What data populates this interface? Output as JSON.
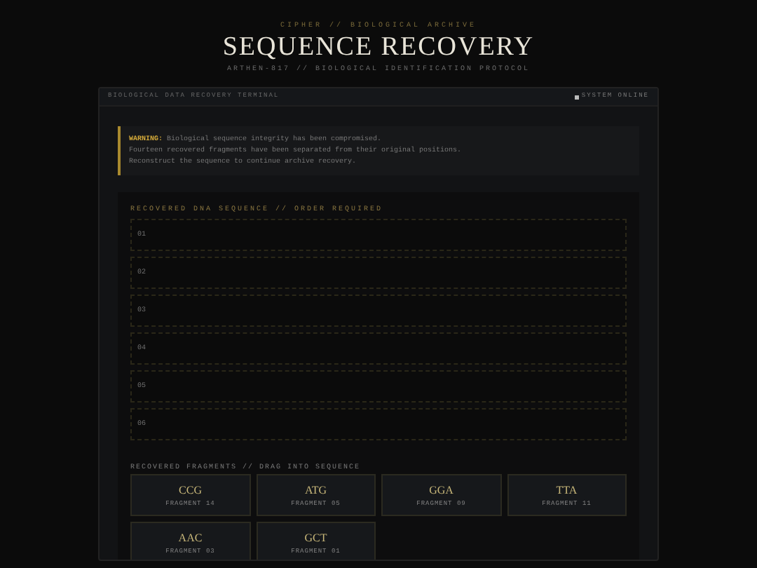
{
  "header": {
    "eyebrow": "CIPHER // BIOLOGICAL ARCHIVE",
    "title": "SEQUENCE RECOVERY",
    "subtitle": "ARTHEN-817 // BIOLOGICAL IDENTIFICATION PROTOCOL"
  },
  "terminal": {
    "title": "BIOLOGICAL DATA RECOVERY TERMINAL",
    "status": "SYSTEM ONLINE"
  },
  "warning": {
    "label": "WARNING:",
    "lines": [
      "Biological sequence integrity has been compromised.",
      "Fourteen recovered fragments have been separated from their original positions.",
      "Reconstruct the sequence to continue archive recovery."
    ]
  },
  "sequence": {
    "heading": "RECOVERED DNA SEQUENCE // ORDER REQUIRED",
    "slots": [
      "01",
      "02",
      "03",
      "04",
      "05",
      "06"
    ]
  },
  "fragments": {
    "heading": "RECOVERED FRAGMENTS // DRAG INTO SEQUENCE",
    "items": [
      {
        "code": "CCG",
        "label": "FRAGMENT 14"
      },
      {
        "code": "ATG",
        "label": "FRAGMENT 05"
      },
      {
        "code": "GGA",
        "label": "FRAGMENT 09"
      },
      {
        "code": "TTA",
        "label": "FRAGMENT 11"
      },
      {
        "code": "AAC",
        "label": "FRAGMENT 03"
      },
      {
        "code": "GCT",
        "label": "FRAGMENT 01"
      }
    ]
  }
}
